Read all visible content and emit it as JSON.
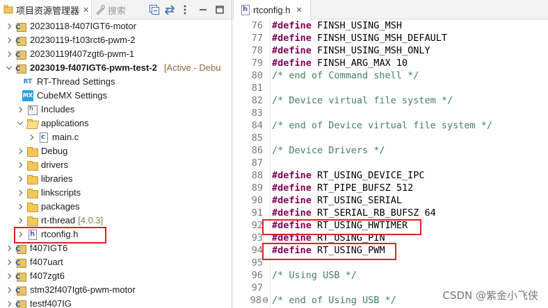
{
  "left_panel": {
    "tabs": [
      {
        "label": "项目资源管理器",
        "close": "✕"
      },
      {
        "label": "搜索"
      }
    ],
    "tree": [
      {
        "label": "20230118-f407IGT6-motor",
        "icon": "project-icon",
        "chevron": "right"
      },
      {
        "label": "20230119-f103rct6-pwm-2",
        "icon": "project-icon",
        "chevron": "right"
      },
      {
        "label": "20230119f407zgt6-pwm-1",
        "icon": "project-icon",
        "chevron": "right"
      },
      {
        "label": "2023019-f407IGT6-pwm-test-2",
        "icon": "project-icon",
        "chevron": "down",
        "bold": true,
        "tag": "[Active - Debu"
      },
      {
        "label": "RT-Thread Settings",
        "icon": "rt-thread-icon"
      },
      {
        "label": "CubeMX Settings",
        "icon": "cubemx-icon"
      },
      {
        "label": "Includes",
        "icon": "includes-icon",
        "chevron": "right"
      },
      {
        "label": "applications",
        "icon": "folder-open-icon",
        "chevron": "down"
      },
      {
        "label": "main.c",
        "icon": "c-file-icon",
        "chevron": "right"
      },
      {
        "label": "Debug",
        "icon": "folder-icon",
        "chevron": "right"
      },
      {
        "label": "drivers",
        "icon": "folder-icon",
        "chevron": "right"
      },
      {
        "label": "libraries",
        "icon": "folder-icon",
        "chevron": "right"
      },
      {
        "label": "linkscripts",
        "icon": "folder-icon",
        "chevron": "right"
      },
      {
        "label": "packages",
        "icon": "folder-icon",
        "chevron": "right"
      },
      {
        "label": "rt-thread",
        "icon": "folder-icon",
        "chevron": "right",
        "version": "[4.0.3]"
      },
      {
        "label": "rtconfig.h",
        "icon": "h-file-icon",
        "chevron": "right"
      },
      {
        "label": "f407IGT6",
        "icon": "project-icon",
        "chevron": "right"
      },
      {
        "label": "f407uart",
        "icon": "project-icon",
        "chevron": "right"
      },
      {
        "label": "f407zgt6",
        "icon": "project-icon",
        "chevron": "right"
      },
      {
        "label": "stm32f407Igt6-pwm-motor",
        "icon": "project-icon",
        "chevron": "right"
      },
      {
        "label": "testf407IG",
        "icon": "project-icon",
        "chevron": "right"
      }
    ]
  },
  "editor": {
    "tab": {
      "label": "rtconfig.h",
      "close": "✕"
    },
    "lines": [
      {
        "num": "76",
        "kw": "#define",
        "text": " FINSH_USING_MSH"
      },
      {
        "num": "77",
        "kw": "#define",
        "text": " FINSH_USING_MSH_DEFAULT"
      },
      {
        "num": "78",
        "kw": "#define",
        "text": " FINSH_USING_MSH_ONLY"
      },
      {
        "num": "79",
        "kw": "#define",
        "text": " FINSH_ARG_MAX 10"
      },
      {
        "num": "80",
        "comment": "/* end of Command shell */"
      },
      {
        "num": "81",
        "text": ""
      },
      {
        "num": "82",
        "comment": "/* Device virtual file system */"
      },
      {
        "num": "83",
        "text": ""
      },
      {
        "num": "84",
        "comment": "/* end of Device virtual file system */"
      },
      {
        "num": "85",
        "text": ""
      },
      {
        "num": "86",
        "comment": "/* Device Drivers */"
      },
      {
        "num": "87",
        "text": ""
      },
      {
        "num": "88",
        "kw": "#define",
        "text": " RT_USING_DEVICE_IPC"
      },
      {
        "num": "89",
        "kw": "#define",
        "text": " RT_PIPE_BUFSZ 512"
      },
      {
        "num": "90",
        "kw": "#define",
        "text": " RT_USING_SERIAL"
      },
      {
        "num": "91",
        "kw": "#define",
        "text": " RT_SERIAL_RB_BUFSZ 64"
      },
      {
        "num": "92",
        "kw": "#define",
        "text": " RT_USING_HWTIMER"
      },
      {
        "num": "93",
        "kw": "#define",
        "text": " RT_USING_PIN"
      },
      {
        "num": "94",
        "kw": "#define",
        "text": " RT_USING_PWM"
      },
      {
        "num": "95",
        "text": ""
      },
      {
        "num": "96",
        "comment": "/* Using USB */"
      },
      {
        "num": "97",
        "text": ""
      },
      {
        "num": "98",
        "fold": "⊖",
        "comment": "/* end of Using USB */"
      }
    ]
  },
  "watermark": "CSDN @紫金小飞侠",
  "colors": {
    "highlight_box": "#e02020",
    "keyword": "#7f0055",
    "comment": "#3f7f5f"
  }
}
